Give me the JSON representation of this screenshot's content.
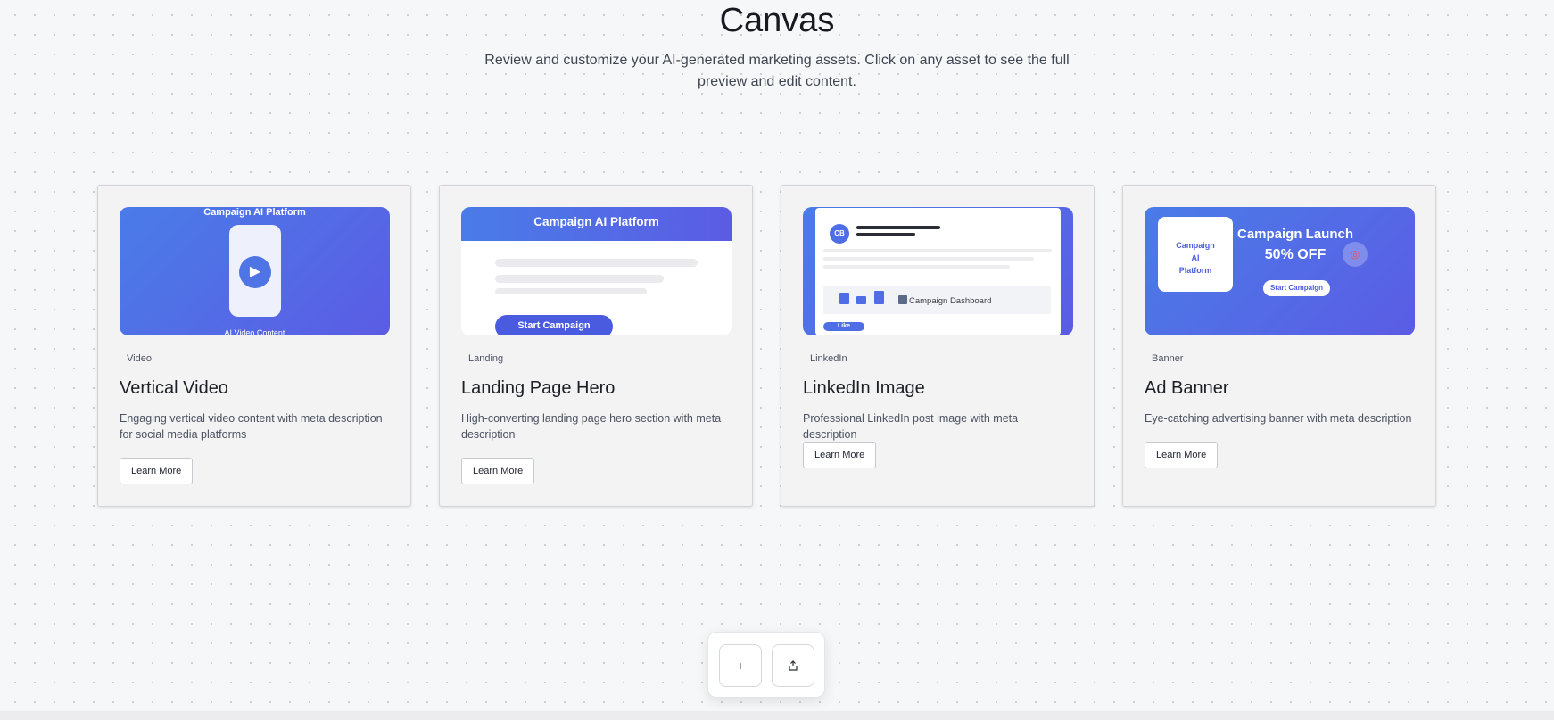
{
  "header": {
    "title": "Canvas",
    "subtitle": "Review and customize your AI-generated marketing assets. Click on any asset to see the full preview and edit content."
  },
  "colors": {
    "accent": "#4f5ee0",
    "gradient_start": "#4a7ce8",
    "gradient_end": "#5b5ce4",
    "background": "#f6f7f9",
    "card_background": "#f3f3f4"
  },
  "cards": [
    {
      "tag": "Video",
      "title": "Vertical Video",
      "description": "Engaging vertical video content with meta description for social media platforms",
      "button": "Learn More",
      "preview": {
        "heading": "Campaign AI Platform",
        "footer": "AI Video Content",
        "icon": "play-icon"
      }
    },
    {
      "tag": "Landing",
      "title": "Landing Page Hero",
      "description": "High-converting landing page hero section with meta description",
      "button": "Learn More",
      "preview": {
        "heading": "Campaign AI Platform",
        "cta": "Start Campaign"
      }
    },
    {
      "tag": "LinkedIn",
      "title": "LinkedIn Image",
      "description": "Professional LinkedIn post image with meta description",
      "button": "Learn More",
      "preview": {
        "avatar": "CB",
        "dashboard": "Campaign Dashboard",
        "like": "Like",
        "icon": "chart-icon"
      }
    },
    {
      "tag": "Banner",
      "title": "Ad Banner",
      "description": "Eye-catching advertising banner with meta description",
      "button": "Learn More",
      "preview": {
        "logo_line1": "Campaign",
        "logo_line2": "AI",
        "logo_line3": "Platform",
        "heading": "Campaign Launch",
        "offer": "50% OFF",
        "cta": "Start Campaign",
        "icon": "target-icon"
      }
    }
  ],
  "toolbar": {
    "add_label": "+",
    "add_icon": "plus-icon",
    "share_icon": "share-icon"
  }
}
